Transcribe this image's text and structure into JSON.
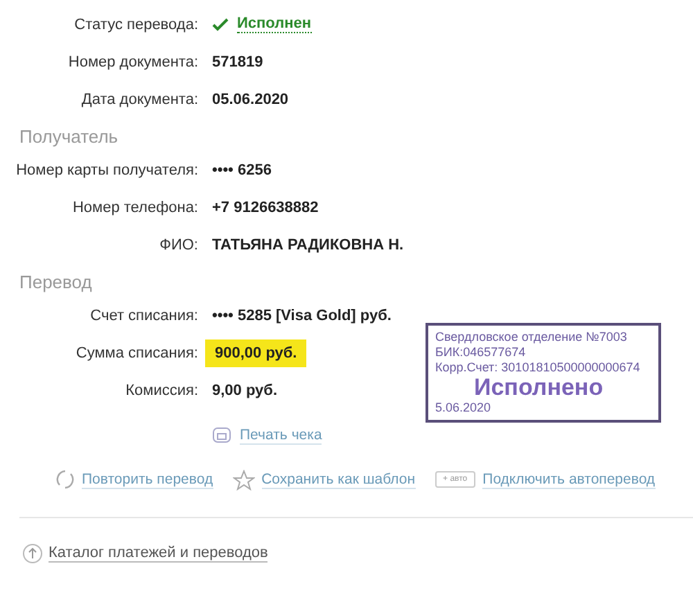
{
  "status": {
    "label": "Статус перевода:",
    "value": "Исполнен"
  },
  "document": [
    {
      "label": "Номер документа:",
      "value": "571819"
    },
    {
      "label": "Дата документа:",
      "value": "05.06.2020"
    }
  ],
  "recipient": {
    "heading": "Получатель",
    "rows": [
      {
        "label": "Номер карты получателя:",
        "value": "•••• 6256"
      },
      {
        "label": "Номер телефона:",
        "value": "+7 9126638882"
      },
      {
        "label": "ФИО:",
        "value": "ТАТЬЯНА РАДИКОВНА Н."
      }
    ]
  },
  "transfer": {
    "heading": "Перевод",
    "rows": [
      {
        "label": "Счет списания:",
        "value": "•••• 5285  [Visa Gold]  руб.",
        "highlight": false
      },
      {
        "label": "Сумма списания:",
        "value": "900,00  руб.",
        "highlight": true
      },
      {
        "label": "Комиссия:",
        "value": "9,00 руб.",
        "highlight": false
      }
    ]
  },
  "stamp": {
    "lines": [
      "Свердловское отделение №7003",
      "БИК:046577674",
      "Корр.Счет: 30101810500000000674"
    ],
    "title": "Исполнено",
    "date": "5.06.2020"
  },
  "print_link": "Печать чека",
  "actions": [
    {
      "kind": "repeat",
      "label": "Повторить перевод"
    },
    {
      "kind": "template",
      "label": "Сохранить как шаблон"
    },
    {
      "kind": "auto",
      "badge": "+ авто",
      "label": "Подключить автоперевод"
    }
  ],
  "catalog_link": "Каталог платежей и переводов"
}
